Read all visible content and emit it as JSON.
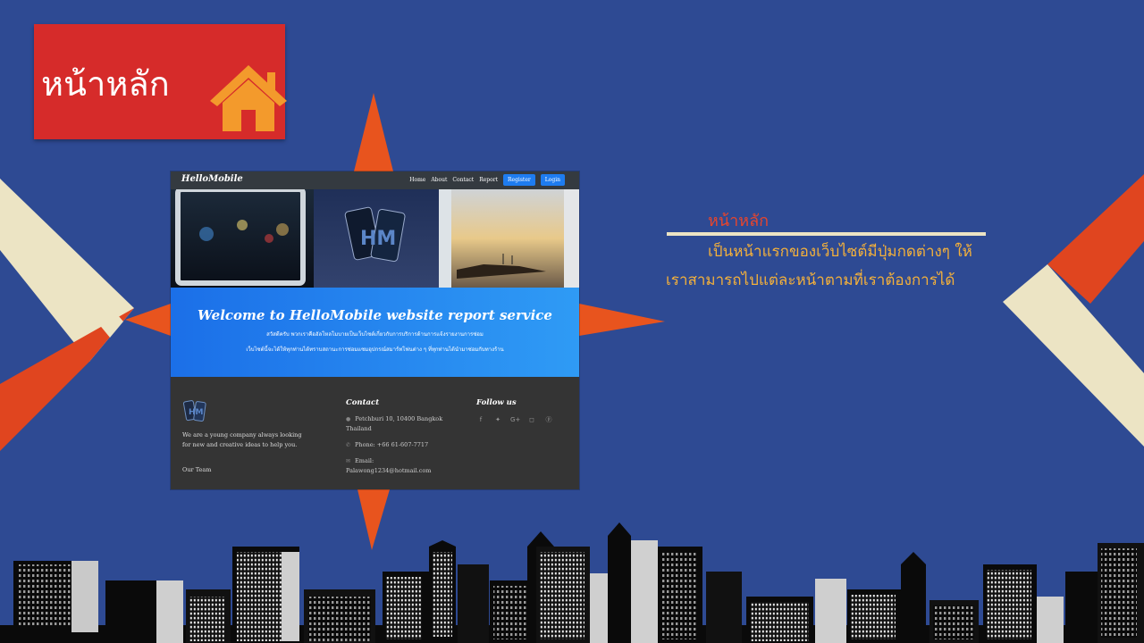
{
  "slide": {
    "title": "หน้าหลัก",
    "home_icon": "home-icon",
    "colors": {
      "background": "#2e4a93",
      "badge": "#d62b2a",
      "accent_orange": "#e8541e",
      "cream": "#ece4c4",
      "text_gold": "#f3b03b",
      "heading_red": "#e8452c"
    }
  },
  "website": {
    "brand": "HelloMobile",
    "nav": [
      "Home",
      "About",
      "Contact",
      "Report"
    ],
    "register_label": "Register",
    "login_label": "Login",
    "hero_title": "Welcome to HelloMobile website report service",
    "hero_line1": "สวัสดีครับ พวกเราคือฮัลโหลโมบายเป็นเว็บไซต์เกี่ยวกับการบริการด้านการแจ้งรายงานการซ่อม",
    "hero_line2": "เว็บไซต์นี้จะได้ให้ทุกท่านได้ทราบสถานะการซ่อมแซมอุปกรณ์สมาร์ทโฟนต่าง ๆ ที่ทุกท่านได้นำมาซ่อมกับทางร้าน",
    "footer": {
      "about": "We are a young company always looking for new and creative ideas to help you.",
      "team_link": "Our Team",
      "contact_heading": "Contact",
      "address": "Petchburi 10, 10400 Bangkok Thailand",
      "phone": "Phone: +66 61-607-7717",
      "email": "Email: Palawong1234@hotmail.com",
      "follow_heading": "Follow us",
      "social_icons": [
        "facebook-icon",
        "twitter-icon",
        "google-plus-icon",
        "instagram-icon",
        "pinterest-icon"
      ]
    }
  },
  "description": {
    "heading": "หน้าหลัก",
    "line1": "เป็นหน้าแรกของเว็บไซต์มีปุ่มกดต่างๆ ให้",
    "line2": "เราสามารถไปแต่ละหน้าตามที่เราต้องการได้"
  }
}
